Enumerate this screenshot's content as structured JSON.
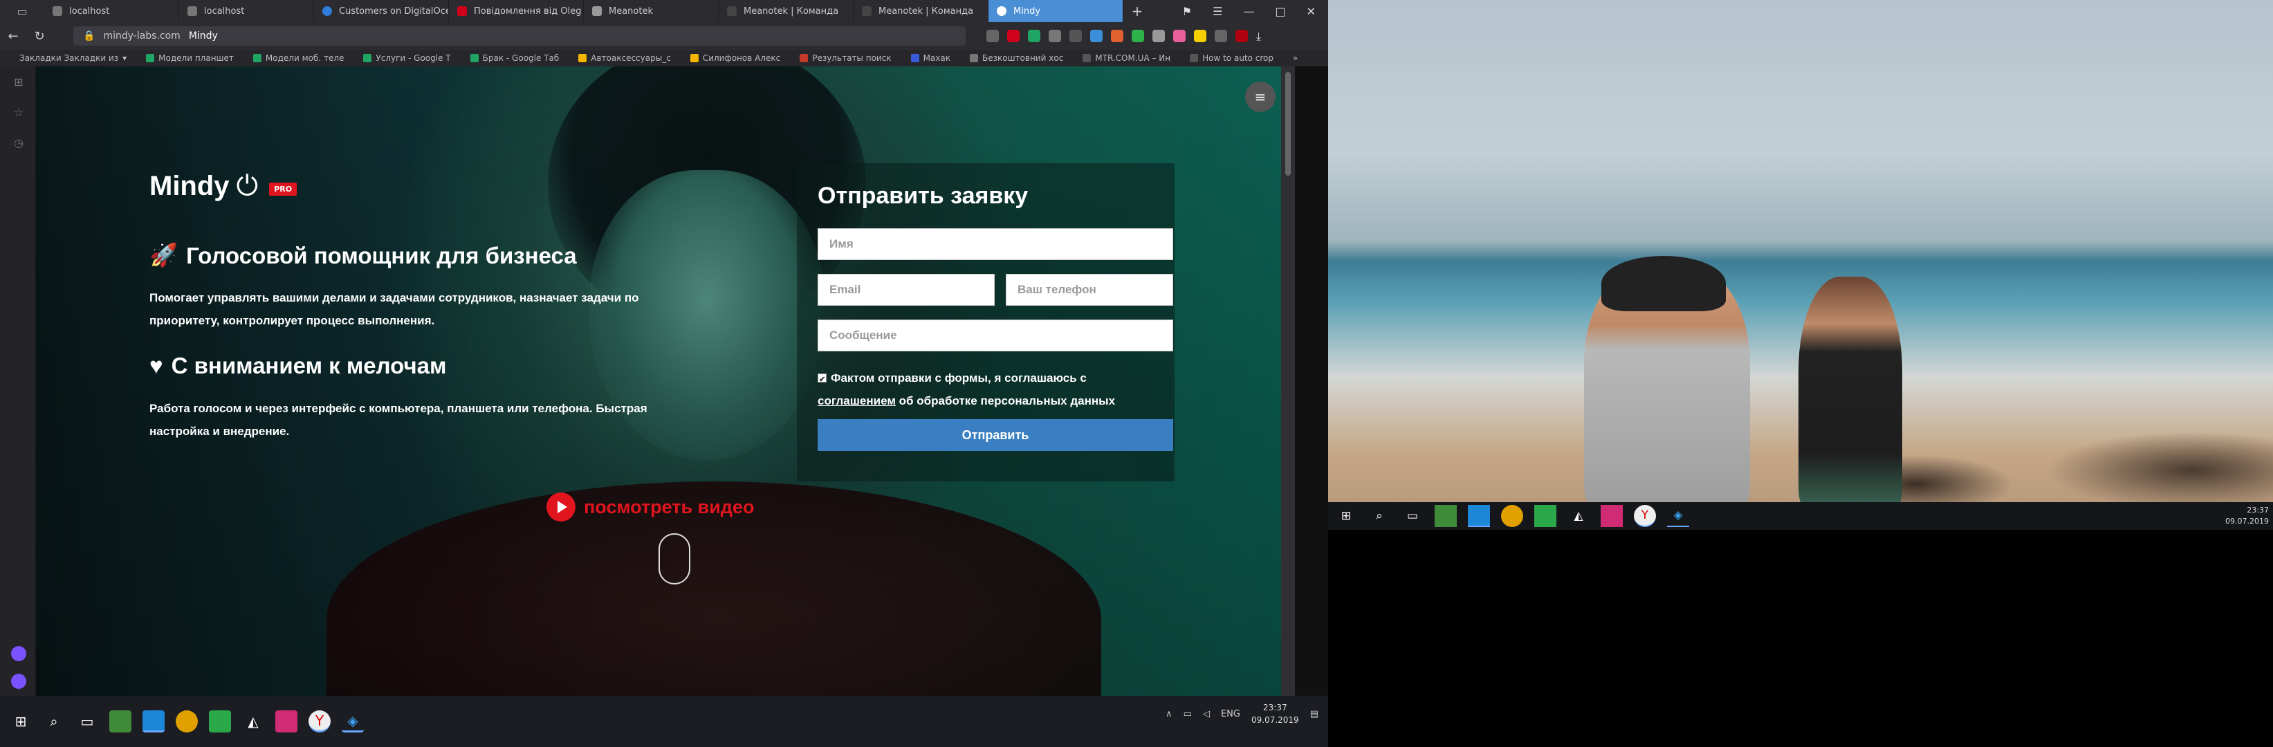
{
  "browser": {
    "tabs": [
      {
        "label": "localhost",
        "color": "#777"
      },
      {
        "label": "localhost",
        "color": "#777"
      },
      {
        "label": "Customers on DigitalOcea",
        "color": "#2f7ddb"
      },
      {
        "label": "Повідомлення від Oleg",
        "color": "#d0021b"
      },
      {
        "label": "Meanotek",
        "color": "#999"
      },
      {
        "label": "Meanotek | Команда",
        "color": "#444"
      },
      {
        "label": "Meanotek | Команда",
        "color": "#444"
      },
      {
        "label": "Mindy",
        "color": "#4a8fd6",
        "active": true
      }
    ],
    "address": {
      "host": "mindy-labs.com",
      "title": "Mindy"
    },
    "bookmarks": [
      {
        "label": "Закладки Закладки из",
        "color": "#ccc"
      },
      {
        "label": "Модели планшет",
        "color": "#1fa463"
      },
      {
        "label": "Модели моб. теле",
        "color": "#1fa463"
      },
      {
        "label": "Услуги - Google Т",
        "color": "#1fa463"
      },
      {
        "label": "Брак - Google Таб",
        "color": "#1fa463"
      },
      {
        "label": "Автоаксессуары_с",
        "color": "#f4b400"
      },
      {
        "label": "Силифонов Алекс",
        "color": "#f4b400"
      },
      {
        "label": "Результаты поиск",
        "color": "#c0392b"
      },
      {
        "label": "Махак",
        "color": "#3b5bdb"
      },
      {
        "label": "Безкоштовний хос",
        "color": "#777"
      },
      {
        "label": "MTR.COM.UA – Ин",
        "color": "#555"
      },
      {
        "label": "How to auto crop",
        "color": "#555"
      }
    ]
  },
  "site": {
    "brand": "Mindy",
    "badge": "PRO",
    "h1": "Голосовой помощник для бизнеса",
    "p1": "Помогает управлять вашими делами и задачами сотрудников, назначает задачи по приоритету, контролирует процесс выполнения.",
    "h2": "С вниманием к мелочам",
    "p2": "Работа голосом и через интерфейс с компьютера, планшета или телефона. Быстрая настройка и внедрение.",
    "video": "посмотреть видео"
  },
  "form": {
    "title": "Отправить заявку",
    "name_ph": "Имя",
    "email_ph": "Email",
    "phone_ph": "Ваш телефон",
    "message_ph": "Сообщение",
    "agree_text": "Фактом отправки с формы, я соглашаюсь с",
    "agree_link": "соглашением",
    "agree_tail": "об обработке персональных данных",
    "submit": "Отправить"
  },
  "taskbar": {
    "lang": "ENG",
    "time": "23:37",
    "date": "09.07.2019"
  },
  "taskbar2": {
    "time": "23:37",
    "date": "09.07.2019"
  }
}
